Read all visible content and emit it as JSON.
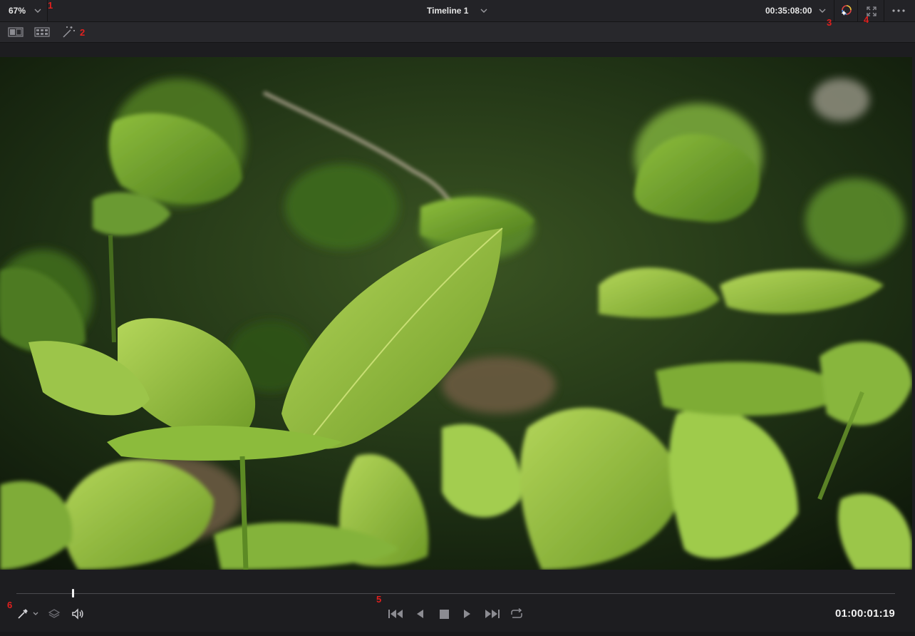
{
  "topbar": {
    "zoom_label": "67%",
    "timeline_label": "Timeline 1",
    "timecode": "00:35:08:00"
  },
  "transport": {
    "timecode": "01:00:01:19",
    "playhead_fraction": 0.064
  },
  "callouts": [
    "1",
    "2",
    "3",
    "4",
    "5",
    "6"
  ],
  "icons": {
    "zoom_dropdown": "chevron-down-icon",
    "timeline_dropdown": "chevron-down-icon",
    "timecode_dropdown": "chevron-down-icon",
    "color_viewer": "color-wheel-icon",
    "fullscreen": "expand-icon",
    "more": "ellipsis-icon",
    "single_viewer": "single-viewer-icon",
    "dual_viewer": "dual-viewer-icon",
    "magic_mask": "magic-wand-icon",
    "picker": "eyedropper-icon",
    "layers": "layers-icon",
    "audio": "speaker-icon",
    "first_frame": "skip-back-icon",
    "reverse": "play-reverse-icon",
    "stop": "stop-icon",
    "play": "play-icon",
    "last_frame": "skip-forward-icon",
    "loop": "loop-icon"
  },
  "colors": {
    "callout": "#e0201e",
    "panel_bg": "#1d1d20",
    "bar_bg": "#232327"
  },
  "viewer": {
    "content": "green hosta leaves"
  }
}
